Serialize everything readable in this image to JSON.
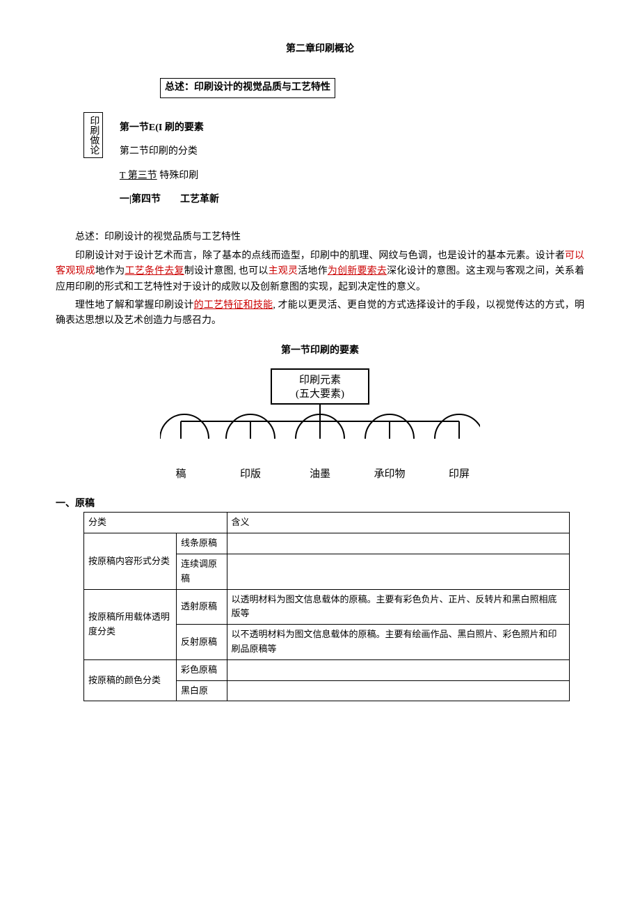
{
  "chapter_title": "第二章印刷概论",
  "summary_box": "总述：印刷设计的视觉品质与工艺特性",
  "vertical_label": "印刷做论",
  "sections": {
    "s1": "第一节E(I 刷的要素",
    "s2": "第二节印刷的分类",
    "s3_prefix": "T 第三节",
    "s3_suffix": "特殊印刷",
    "s4_prefix": "一|第四节",
    "s4_space": "　　",
    "s4_suffix": "工艺革新"
  },
  "body_heading": "总述：印刷设计的视觉品质与工艺特性",
  "p1": {
    "a": "印刷设计对于设计艺术而言，除了基本的点线而造型，印刷中的肌理、网纹与色调，也是设计的基本元素。设计者",
    "b": "可以客观现成",
    "c": "地作为",
    "d": "工艺条件去复",
    "e": "制设计意图, 也可以",
    "f": "主观灵",
    "g": "活地作",
    "h": "为创新要索去",
    "i": "深化设计的意图。这主观与客观之间，关系着应用印刷的形式和工艺特性对于设计的成败以及创新意图的实现，起到决定性的意义。"
  },
  "p2": {
    "a": "理性地了解和掌握印刷设计",
    "b": "的工艺特征和技能",
    "c": ", 才能以更灵活、更自觉的方式选择设计的手段，以视觉传达的方式，明确表达思想以及艺术创造力与感召力。"
  },
  "section1_title": "第一节印刷的要素",
  "diagram": {
    "top_line1": "印刷元素",
    "top_line2": "(五大要素)",
    "items": [
      "稿",
      "印版",
      "油墨",
      "承印物",
      "印屏"
    ]
  },
  "tbl_heading": "一、原稿",
  "tbl_headers": {
    "c1": "分类",
    "c2": "含义"
  },
  "rows": {
    "r1": {
      "cat": "按原稿内容形式分类",
      "sub1": "线条原稿",
      "m1": "",
      "sub2": "连续调原稿",
      "m2": ""
    },
    "r2": {
      "cat": "按原稿所用载体透明度分类",
      "sub1": "透射原稿",
      "m1": "以透明材料为图文信息载体的原稿。主要有彩色负片、正片、反转片和黑白照相底版等",
      "sub2": "反射原稿",
      "m2": "以不透明材料为图文信息载体的原稿。主要有绘画作品、黑白照片、彩色照片和印刷品原稿等"
    },
    "r3": {
      "cat": "按原稿的颜色分类",
      "sub1": "彩色原稿",
      "m1": "",
      "sub2": "黑白原",
      "m2": ""
    }
  }
}
